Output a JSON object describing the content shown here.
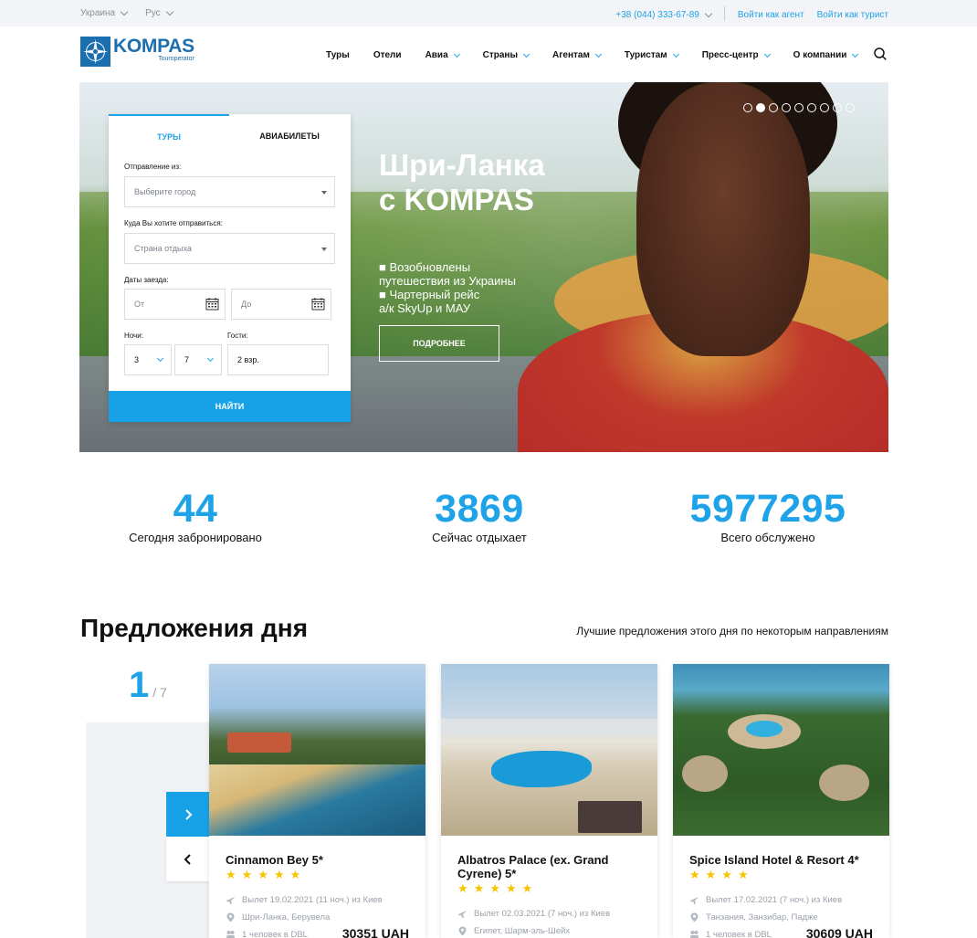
{
  "topbar": {
    "country": "Украина",
    "language": "Рус",
    "phone": "+38 (044) 333-67-89",
    "agent_login": "Войти как агент",
    "tourist_login": "Войти как турист"
  },
  "logo": {
    "name": "KOMPAS",
    "sub": "Touroperator"
  },
  "nav": [
    {
      "label": "Туры",
      "dropdown": false
    },
    {
      "label": "Отели",
      "dropdown": false
    },
    {
      "label": "Авиа",
      "dropdown": true
    },
    {
      "label": "Страны",
      "dropdown": true
    },
    {
      "label": "Агентам",
      "dropdown": true
    },
    {
      "label": "Туристам",
      "dropdown": true
    },
    {
      "label": "Пресс-центр",
      "dropdown": true
    },
    {
      "label": "О компании",
      "dropdown": true
    }
  ],
  "hero": {
    "title_line1": "Шри-Ланка",
    "title_line2": "с KOMPAS",
    "bullet1_line1": "■ Возобновлены",
    "bullet1_line2": "путешествия из Украины",
    "bullet2_line1": "■ Чартерный рейс",
    "bullet2_line2": "а/к SkyUp и МАУ",
    "button": "ПОДРОБНЕЕ",
    "slides_total": 9,
    "active_slide": 2
  },
  "search": {
    "tab_tours": "ТУРЫ",
    "tab_flights": "АВИАБИЛЕТЫ",
    "departure_label": "Отправление из:",
    "departure_placeholder": "Выберите город",
    "destination_label": "Куда Вы хотите отправиться:",
    "destination_placeholder": "Страна отдыха",
    "dates_label": "Даты заезда:",
    "date_from": "От",
    "date_to": "До",
    "nights_label": "Ночи:",
    "nights_from": "3",
    "nights_to": "7",
    "guests_label": "Гости:",
    "guests_value": "2 взр.",
    "submit": "НАЙТИ"
  },
  "stats": [
    {
      "value": "44",
      "label": "Сегодня забронировано"
    },
    {
      "value": "3869",
      "label": "Сейчас отдыхает"
    },
    {
      "value": "5977295",
      "label": "Всего обслужено"
    }
  ],
  "offers": {
    "title": "Предложения дня",
    "subtitle": "Лучшие предложения этого дня по некоторым направлениям",
    "current": "1",
    "total": "/ 7",
    "cards": [
      {
        "name": "Cinnamon Bey 5*",
        "stars": 5,
        "stars_text": "★★★★★",
        "departure": "Вылет 19.02.2021 (11 ноч.) из Киев",
        "location": "Шри-Ланка, Берувела",
        "people": "1 человек в DBL",
        "price": "30351 UAH"
      },
      {
        "name": "Albatros Palace (ex. Grand Cyrene) 5*",
        "stars": 5,
        "stars_text": "★★★★★",
        "departure": "Вылет 02.03.2021 (7 ноч.) из Киев",
        "location": "Египет, Шарм-эль-Шейх",
        "people": "",
        "price": ""
      },
      {
        "name": "Spice Island Hotel & Resort 4*",
        "stars": 4,
        "stars_text": "★★★★",
        "departure": "Вылет 17.02.2021 (7 ноч.) из Киев",
        "location": "Танзания, Занзибар, Падже",
        "people": "1 человек в DBL",
        "price": "30609 UAH"
      }
    ]
  },
  "colors": {
    "accent": "#17a2e8",
    "brand": "#1b6fae",
    "star": "#f6c400"
  }
}
